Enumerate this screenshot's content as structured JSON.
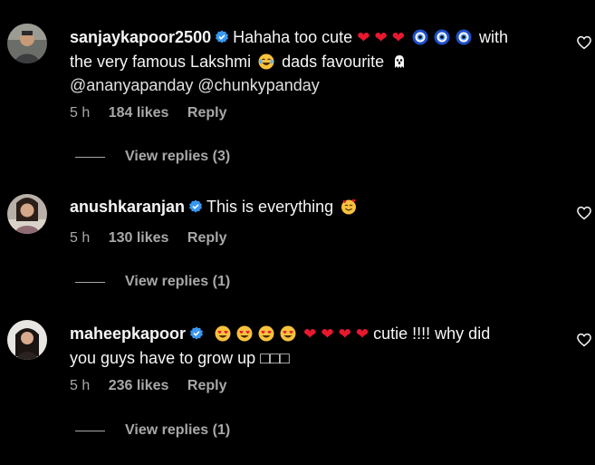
{
  "comments": [
    {
      "username": "sanjaykapoor2500",
      "text_1": "Hahaha too cute",
      "text_2": "with",
      "text_3": "the very famous Lakshmi",
      "text_4": "dads favourite",
      "mentions": [
        "@ananyapanday",
        "@chunkypanday"
      ],
      "time": "5 h",
      "likes": "184 likes",
      "reply": "Reply",
      "view_replies": "View replies (3)"
    },
    {
      "username": "anushkaranjan",
      "text_1": "This is everything",
      "time": "5 h",
      "likes": "130 likes",
      "reply": "Reply",
      "view_replies": "View replies (1)"
    },
    {
      "username": "maheepkapoor",
      "text_1": "cutie !!!! why did",
      "text_2": "you guys have to grow up",
      "text_3": "□□□",
      "time": "5 h",
      "likes": "236 likes",
      "reply": "Reply",
      "view_replies": "View replies (1)"
    }
  ],
  "colors": {
    "background": "#000000",
    "text": "#f5f5f5",
    "muted": "#a8a8a8",
    "verified": "#3897f0",
    "heart": "#e8182f"
  },
  "icons": [
    "verified-badge-icon",
    "heart-outline-icon",
    "red-heart-emoji",
    "nazar-amulet-emoji",
    "tears-of-joy-emoji",
    "ghost-emoji",
    "smiling-face-with-hearts-emoji",
    "heart-eyes-emoji"
  ]
}
